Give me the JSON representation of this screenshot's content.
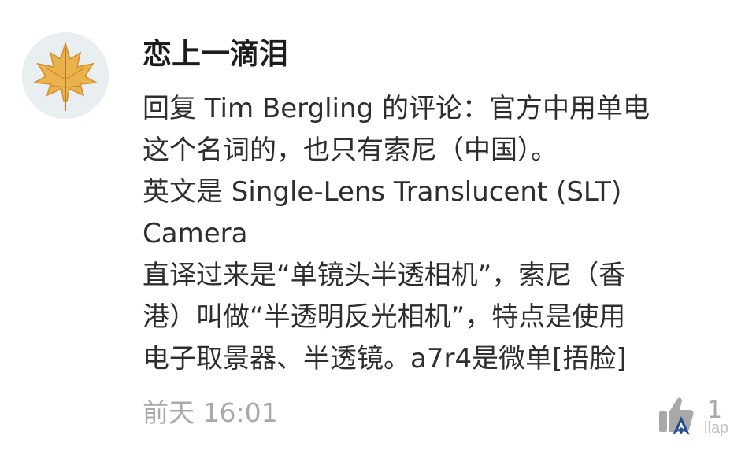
{
  "comment": {
    "avatar_icon": "maple-leaf-icon",
    "username": "恋上一滴泪",
    "lines": [
      "回复 Tim Bergling 的评论：官方中用单电",
      "这个名词的，也只有索尼（中国）。",
      "英文是 Single-Lens Translucent (SLT)",
      "Camera",
      "直译过来是“单镜头半透相机”，索尼（香",
      "港）叫做“半透明反光相机”，特点是使用",
      "电子取景器、半透镜。a7r4是微单[捂脸]"
    ],
    "time": "前天 16:01",
    "like_icon": "thumbs-up-icon",
    "like_count": "1"
  },
  "watermark": {
    "icon": "app-logo-icon",
    "text": "llap"
  },
  "colors": {
    "username": "#1c1c1c",
    "text": "#2e2e2e",
    "meta": "#a9a9a9",
    "avatar_bg": "#e9eef1",
    "leaf": "#e8b04a"
  }
}
